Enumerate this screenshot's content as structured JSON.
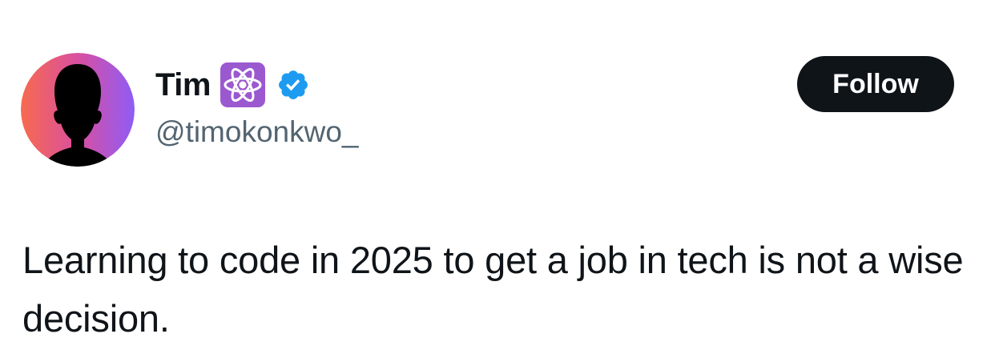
{
  "author": {
    "display_name": "Tim",
    "handle": "@timokonkwo_",
    "badges": {
      "emoji_badge_icon": "atom-symbol-icon",
      "verified_icon": "verified-badge-icon",
      "verified_color": "#1d9bf0",
      "emoji_badge_color": "#9b59d0"
    },
    "avatar_icon": "silhouette-avatar-icon",
    "avatar_gradient": [
      "#f76a4f",
      "#d94fa0",
      "#8f5cf5"
    ]
  },
  "follow_button": {
    "label": "Follow",
    "background": "#0f1419",
    "color": "#ffffff"
  },
  "tweet": {
    "text": "Learning to code in 2025 to get a job in tech is not a wise decision."
  }
}
